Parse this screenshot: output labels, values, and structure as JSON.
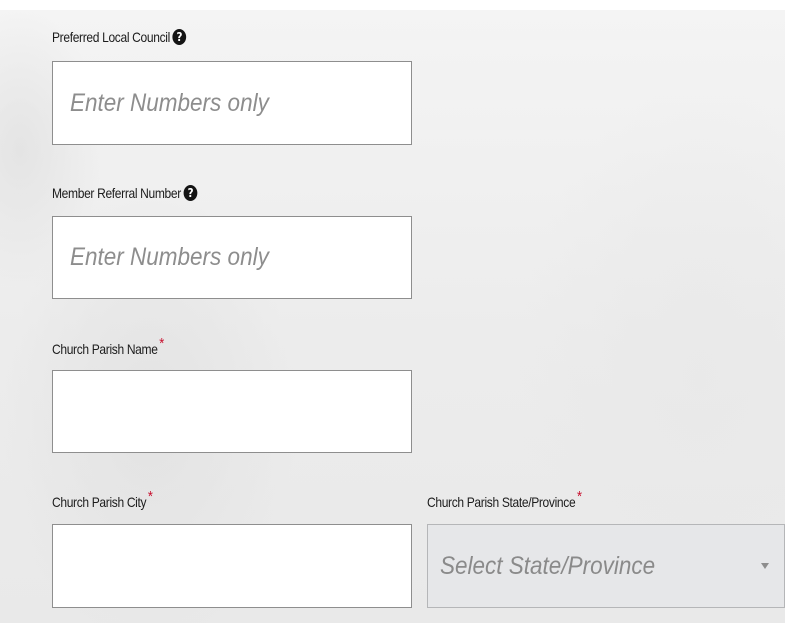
{
  "form": {
    "local_council": {
      "label": "Preferred Local Council",
      "help_glyph": "?",
      "placeholder": "Enter Numbers only",
      "value": ""
    },
    "referral_number": {
      "label": "Member Referral Number",
      "help_glyph": "?",
      "placeholder": "Enter Numbers only",
      "value": ""
    },
    "parish_name": {
      "label": "Church Parish Name",
      "required_mark": "*",
      "value": ""
    },
    "parish_city": {
      "label": "Church Parish City",
      "required_mark": "*",
      "value": ""
    },
    "parish_state": {
      "label": "Church Parish State/Province",
      "required_mark": "*",
      "selected": "Select State/Province"
    }
  },
  "icons": {
    "help": "question-circle-icon",
    "dropdown": "caret-down-icon"
  },
  "colors": {
    "required": "#c8102e",
    "input_border": "#8e8e8e",
    "placeholder": "#8d8d8d",
    "select_bg": "#e6e7e9"
  }
}
